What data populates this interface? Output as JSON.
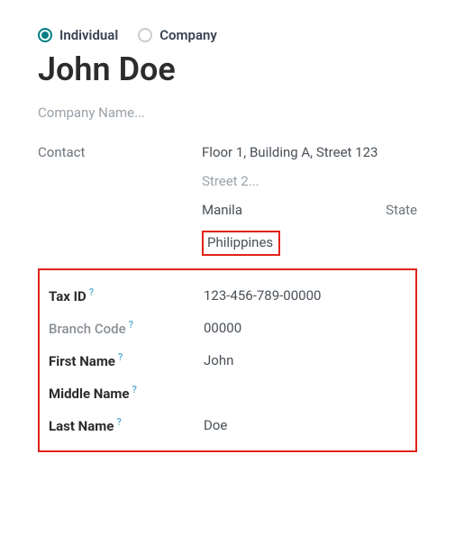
{
  "contactType": {
    "options": [
      {
        "label": "Individual",
        "selected": true
      },
      {
        "label": "Company",
        "selected": false
      }
    ]
  },
  "name": "John Doe",
  "companyPlaceholder": "Company Name...",
  "address": {
    "label": "Contact",
    "street1": "Floor 1, Building A, Street 123",
    "street2_placeholder": "Street 2...",
    "city": "Manila",
    "state_placeholder": "State",
    "country": "Philippines"
  },
  "fields": {
    "taxId": {
      "label": "Tax ID",
      "value": "123-456-789-00000"
    },
    "branchCode": {
      "label": "Branch Code",
      "value": "00000"
    },
    "firstName": {
      "label": "First Name",
      "value": "John"
    },
    "middleName": {
      "label": "Middle Name",
      "value": ""
    },
    "lastName": {
      "label": "Last Name",
      "value": "Doe"
    }
  },
  "helpGlyph": "?"
}
